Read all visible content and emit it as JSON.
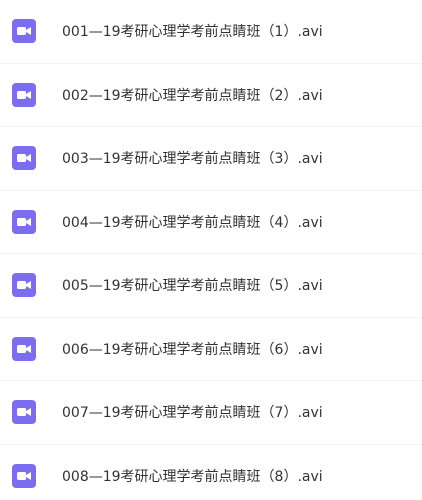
{
  "files": [
    {
      "name": "001—19考研心理学考前点睛班（1）.avi",
      "icon": "video-file-icon"
    },
    {
      "name": "002—19考研心理学考前点睛班（2）.avi",
      "icon": "video-file-icon"
    },
    {
      "name": "003—19考研心理学考前点睛班（3）.avi",
      "icon": "video-file-icon"
    },
    {
      "name": "004—19考研心理学考前点睛班（4）.avi",
      "icon": "video-file-icon"
    },
    {
      "name": "005—19考研心理学考前点睛班（5）.avi",
      "icon": "video-file-icon"
    },
    {
      "name": "006—19考研心理学考前点睛班（6）.avi",
      "icon": "video-file-icon"
    },
    {
      "name": "007—19考研心理学考前点睛班（7）.avi",
      "icon": "video-file-icon"
    },
    {
      "name": "008—19考研心理学考前点睛班（8）.avi",
      "icon": "video-file-icon"
    }
  ],
  "colors": {
    "icon_bg": "#7c6cf0",
    "icon_fg": "#ffffff",
    "text": "#333333",
    "divider": "#f2f2f2"
  }
}
